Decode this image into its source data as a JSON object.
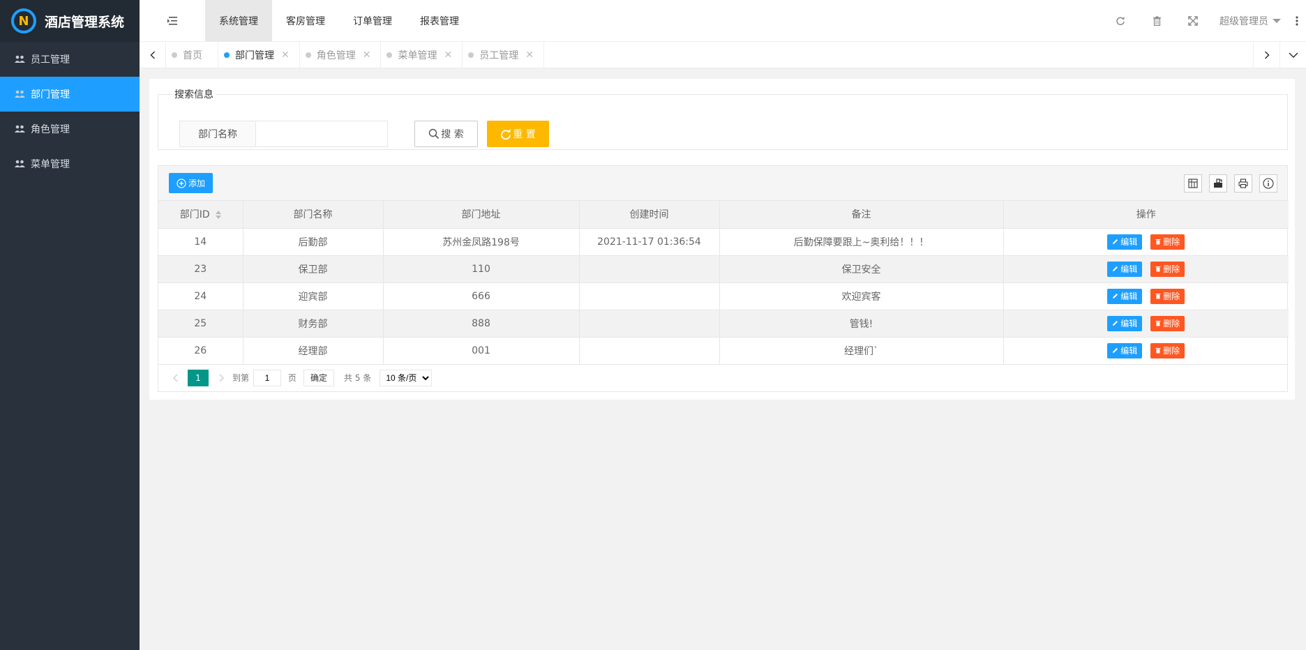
{
  "app": {
    "title": "酒店管理系统",
    "logo_glyph": "N"
  },
  "sidebar": {
    "items": [
      {
        "label": "员工管理",
        "icon": "users-icon"
      },
      {
        "label": "部门管理",
        "icon": "users-icon",
        "active": true
      },
      {
        "label": "角色管理",
        "icon": "users-icon"
      },
      {
        "label": "菜单管理",
        "icon": "users-icon"
      }
    ]
  },
  "header": {
    "tabs": [
      {
        "label": "系统管理",
        "active": true
      },
      {
        "label": "客房管理"
      },
      {
        "label": "订单管理"
      },
      {
        "label": "报表管理"
      }
    ],
    "user_name": "超级管理员",
    "icons": [
      "refresh-icon",
      "trash-icon",
      "fullscreen-icon",
      "more-vertical-icon"
    ]
  },
  "page_tabs": [
    {
      "label": "首页",
      "closable": false
    },
    {
      "label": "部门管理",
      "closable": true,
      "active": true
    },
    {
      "label": "角色管理",
      "closable": true
    },
    {
      "label": "菜单管理",
      "closable": true
    },
    {
      "label": "员工管理",
      "closable": true
    }
  ],
  "search": {
    "legend": "搜索信息",
    "field_label": "部门名称",
    "field_value": "",
    "search_button": "搜 索",
    "reset_button": "重 置"
  },
  "toolbar": {
    "add_button": "添加",
    "tool_icons": [
      "columns-icon",
      "export-icon",
      "print-icon",
      "info-icon"
    ]
  },
  "table": {
    "columns": [
      "部门ID",
      "部门名称",
      "部门地址",
      "创建时间",
      "备注",
      "操作"
    ],
    "rows": [
      {
        "id": "14",
        "name": "后勤部",
        "address": "苏州金凤路198号",
        "created": "2021-11-17 01:36:54",
        "remark": "后勤保障要跟上~奥利给！！！"
      },
      {
        "id": "23",
        "name": "保卫部",
        "address": "110",
        "created": "",
        "remark": "保卫安全"
      },
      {
        "id": "24",
        "name": "迎宾部",
        "address": "666",
        "created": "",
        "remark": "欢迎宾客"
      },
      {
        "id": "25",
        "name": "财务部",
        "address": "888",
        "created": "",
        "remark": "管钱!"
      },
      {
        "id": "26",
        "name": "经理部",
        "address": "001",
        "created": "",
        "remark": "经理们`"
      }
    ],
    "edit_label": "编辑",
    "delete_label": "删除"
  },
  "pagination": {
    "current_page": "1",
    "goto_label": "到第",
    "goto_value": "1",
    "page_unit": "页",
    "confirm_label": "确定",
    "total_label": "共 5 条",
    "page_size": "10 条/页"
  },
  "colors": {
    "sidebar_bg": "#28313c",
    "accent": "#1e9fff",
    "warning": "#ffb800",
    "danger": "#ff5722",
    "pager_active": "#009688"
  }
}
